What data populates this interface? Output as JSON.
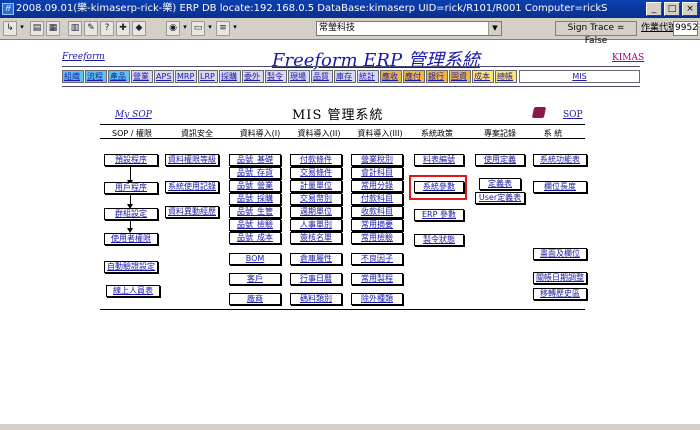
{
  "window": {
    "title": "2008.09.01(樂-kimaserp-rick-樂) ERP DB locate:192.168.0.5 DataBase:kimaserp UID=rick/R101/R001 Computer=rickS",
    "app_icon": "ff"
  },
  "toolbar": {
    "company": "常瑩科技",
    "sign_trace": "Sign Trace = False",
    "operator_label": "作業代號",
    "operator_code": "9952"
  },
  "header": {
    "brand": "Freeform",
    "title": "Freeform ERP 管理系統",
    "right_link": "KIMAS"
  },
  "nav": {
    "items": [
      {
        "label": "組織",
        "style": "a"
      },
      {
        "label": "流程",
        "style": "a"
      },
      {
        "label": "產品",
        "style": "a"
      },
      {
        "label": "營業",
        "style": "b"
      },
      {
        "label": "APS",
        "style": "b"
      },
      {
        "label": "MRP",
        "style": "b"
      },
      {
        "label": "LRP",
        "style": "b"
      },
      {
        "label": "採購",
        "style": "b"
      },
      {
        "label": "委外",
        "style": "b"
      },
      {
        "label": "製令",
        "style": "b"
      },
      {
        "label": "現場",
        "style": "b"
      },
      {
        "label": "品質",
        "style": "b"
      },
      {
        "label": "庫存",
        "style": "b"
      },
      {
        "label": "統計",
        "style": "b"
      },
      {
        "label": "應收",
        "style": "c"
      },
      {
        "label": "應付",
        "style": "c"
      },
      {
        "label": "銀行",
        "style": "c"
      },
      {
        "label": "固資",
        "style": "c"
      },
      {
        "label": "成本",
        "style": "d"
      },
      {
        "label": "總帳",
        "style": "d"
      }
    ],
    "mis_link": "MIS"
  },
  "mis": {
    "my_sop": "My SOP",
    "title": "MIS 管理系統",
    "sop": "SOP",
    "columns": [
      "SOP / 權限",
      "資訊安全",
      "資料導入(I)",
      "資料導入(II)",
      "資料導入(III)",
      "系統政策",
      "專案記錄",
      "系 統"
    ],
    "sop_col": [
      "預設程序",
      "用戶程序",
      "群組設定",
      "使用者權限",
      "自動驗證設定",
      "線上人員表"
    ],
    "security_col": [
      "資料權限等級",
      "系統使用記錄",
      "資料異動經歷"
    ],
    "import1_col": [
      "品號_基礎",
      "品號_存貨",
      "品號_營業",
      "品號_採購",
      "品號_生管",
      "品號_檢驗",
      "品號_成本",
      "BOM",
      "客戶",
      "廠商"
    ],
    "import2_col": [
      "付款條件",
      "交易條件",
      "計量單位",
      "交易幣別",
      "週期單位",
      "人事單別",
      "簽核名單",
      "倉庫屬性",
      "行事日曆",
      "碼料類別"
    ],
    "import3_col": [
      "營業稅別",
      "會計科目",
      "常用分錄",
      "付款科目",
      "收款科目",
      "常用摘要",
      "常用檢驗",
      "不良因子",
      "常用製程",
      "除外種類"
    ],
    "policy_col": [
      "料表編號",
      "系統參數",
      "ERP 參數",
      "製令狀態"
    ],
    "project_col": [
      "使用定義",
      "定義表",
      "User定義表"
    ],
    "system_col": [
      "系統功能表",
      "欄位長度",
      "畫面及欄位",
      "關帳日期調整",
      "移轉歷史區"
    ]
  }
}
